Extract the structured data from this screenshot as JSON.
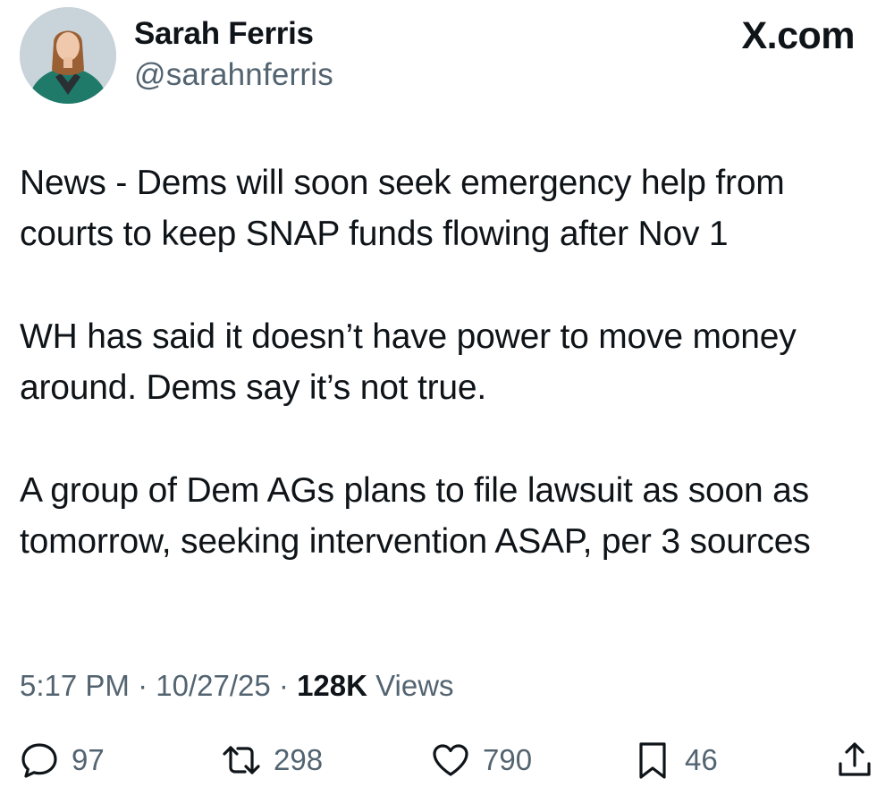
{
  "author": {
    "name": "Sarah Ferris",
    "handle": "@sarahnferris"
  },
  "brand": "X.com",
  "tweet": {
    "paragraphs": [
      "News - Dems will soon seek emergency help from courts to keep SNAP funds flowing after Nov 1",
      "WH has said it doesn’t have power to move money around. Dems say it’s not true.",
      "A group of Dem AGs plans to file lawsuit as soon as tomorrow, seeking intervention ASAP, per 3 sources"
    ]
  },
  "meta": {
    "time": "5:17 PM",
    "date": "10/27/25",
    "views_count": "128K",
    "views_label": "Views"
  },
  "actions": {
    "replies": "97",
    "reposts": "298",
    "likes": "790",
    "bookmarks": "46"
  },
  "icons": [
    "reply-icon",
    "repost-icon",
    "like-icon",
    "bookmark-icon",
    "share-icon"
  ],
  "colors": {
    "text": "#0f1419",
    "secondary": "#536471",
    "jacket": "#1f7a6a"
  }
}
